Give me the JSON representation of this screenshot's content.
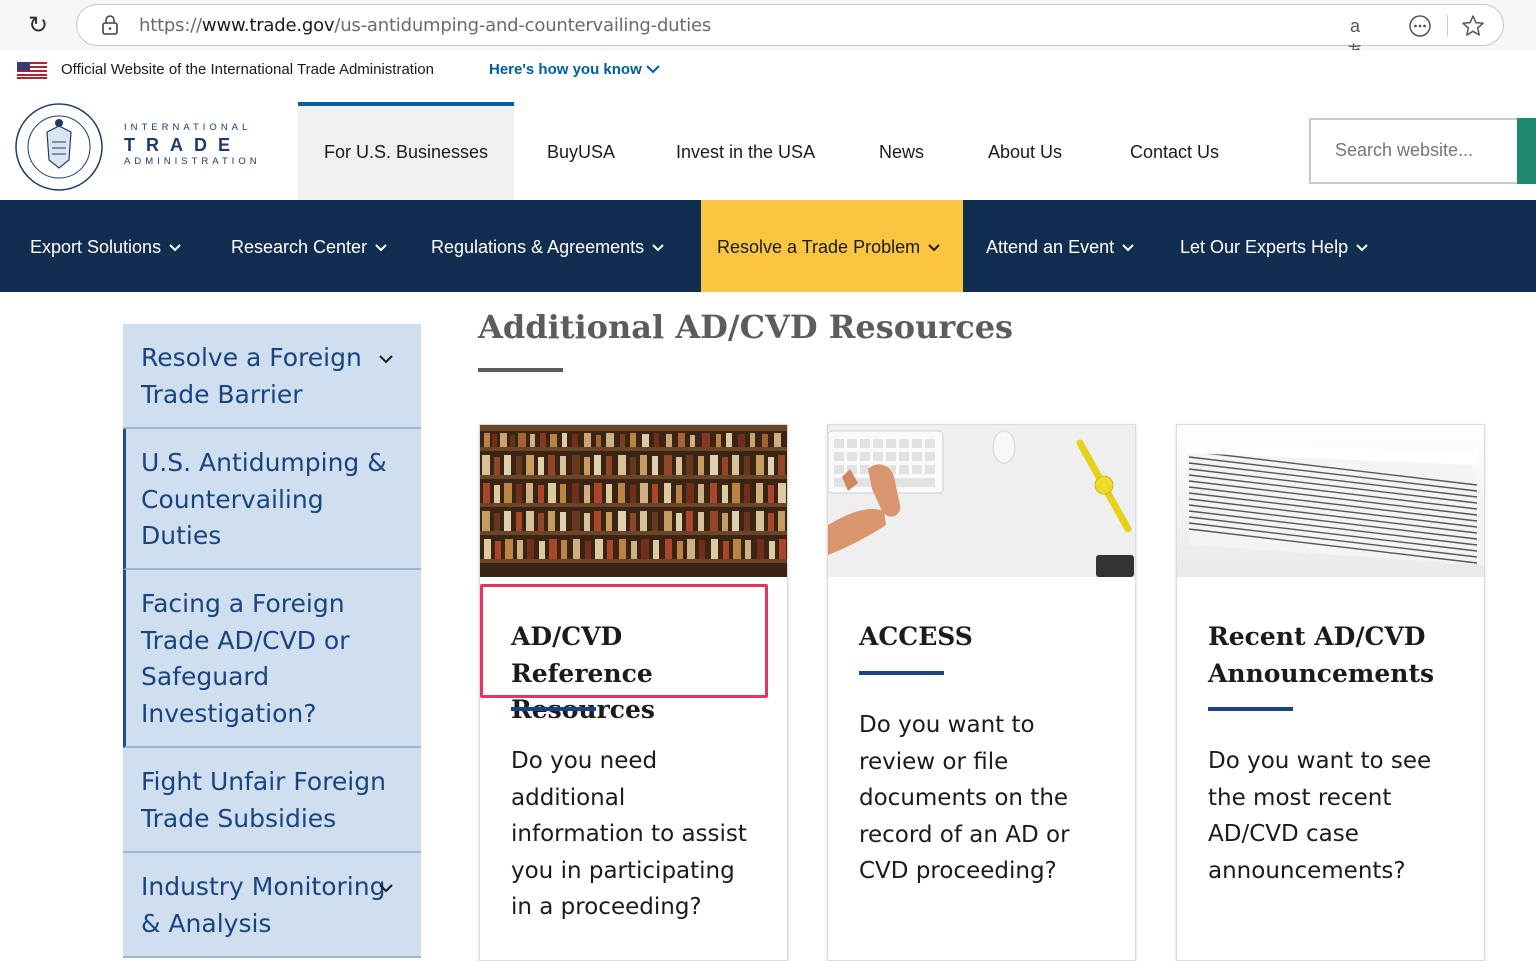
{
  "browser": {
    "url_scheme": "https://",
    "url_host": "www.trade.gov",
    "url_path": "/us-antidumping-and-countervailing-duties",
    "read_aloud_icon": "aあ"
  },
  "gov_banner": {
    "text": "Official Website of the International Trade Administration",
    "link": "Here's how you know"
  },
  "logo": {
    "line1": "INTERNATIONAL",
    "line2": "TRADE",
    "line3": "ADMINISTRATION"
  },
  "top_nav": [
    "For U.S. Businesses",
    "BuyUSA",
    "Invest in the USA",
    "News",
    "About Us",
    "Contact Us"
  ],
  "search": {
    "placeholder": "Search website..."
  },
  "sub_nav": [
    "Export Solutions",
    "Research Center",
    "Regulations & Agreements",
    "Resolve a Trade Problem",
    "Attend an Event",
    "Let Our Experts Help"
  ],
  "sidebar": [
    {
      "lines": [
        "Resolve a Foreign",
        "Trade Barrier"
      ],
      "expandable": true
    },
    {
      "lines": [
        "U.S. Antidumping &",
        "Countervailing",
        "Duties"
      ],
      "expandable": false,
      "current": true
    },
    {
      "lines": [
        "Facing a Foreign",
        "Trade AD/CVD or",
        "Safeguard",
        "Investigation?"
      ],
      "expandable": false
    },
    {
      "lines": [
        "Fight Unfair Foreign",
        "Trade Subsidies"
      ],
      "expandable": false
    },
    {
      "lines": [
        "Industry Monitoring",
        "& Analysis"
      ],
      "expandable": true
    }
  ],
  "main": {
    "title": "Additional AD/CVD Resources",
    "cards": [
      {
        "title_lines": [
          "AD/CVD Reference",
          "Resources"
        ],
        "desc_lines": [
          "Do you need",
          "additional",
          "information to assist",
          "you in participating",
          "in a proceeding?"
        ],
        "image": "bookshelf-photo"
      },
      {
        "title_lines": [
          "ACCESS"
        ],
        "desc_lines": [
          "Do you want to",
          "review or file",
          "documents on the",
          "record of an AD or",
          "CVD proceeding?"
        ],
        "image": "keyboard-photo"
      },
      {
        "title_lines": [
          "Recent AD/CVD",
          "Announcements"
        ],
        "desc_lines": [
          "Do you want to see",
          "the most recent",
          "AD/CVD case",
          "announcements?"
        ],
        "image": "paper-stack-photo"
      }
    ]
  },
  "colors": {
    "navy": "#112e51",
    "highlight_yellow": "#fac641",
    "link_blue": "#1a4480",
    "sidebar_bg": "#cfdfef",
    "annotation_red": "#e8345a"
  }
}
